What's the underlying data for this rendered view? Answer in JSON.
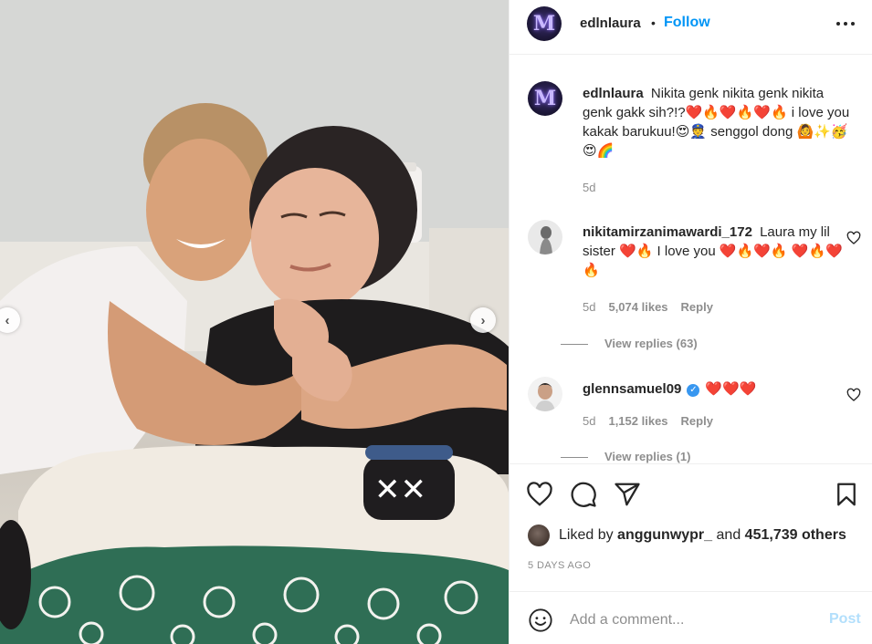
{
  "post": {
    "author": "edlnlaura",
    "follow_label": "Follow",
    "separator": "•",
    "caption": {
      "username": "edlnlaura",
      "text": "Nikita genk nikita genk nikita genk gakk sih?!?❤️🔥❤️🔥❤️🔥 i love you kakak barukuu!😍👮 senggol dong 🙆✨🥳😍🌈",
      "age": "5d"
    },
    "comments": [
      {
        "username": "nikitamirzanimawardi_172",
        "text": "Laura my lil sister ❤️🔥 I love you ❤️🔥❤️🔥 ❤️🔥❤️🔥",
        "age": "5d",
        "likes": "5,074 likes",
        "reply_label": "Reply",
        "view_replies": "View replies (63)"
      },
      {
        "username": "glennsamuel09",
        "verified": "✓",
        "text": "❤️❤️❤️",
        "age": "5d",
        "likes": "1,152 likes",
        "reply_label": "Reply",
        "view_replies": "View replies (1)"
      }
    ],
    "liked_by_prefix": "Liked by",
    "liked_by_user": "anggunwypr_",
    "liked_by_and": "and",
    "liked_by_others": "451,739 others",
    "timestamp": "5 DAYS AGO",
    "comment_placeholder": "Add a comment...",
    "post_label": "Post",
    "carousel": {
      "prev": "‹",
      "next": "›"
    },
    "logo_letter": "M"
  },
  "icons": {
    "more": "more-options-icon",
    "like": "heart-icon",
    "comment": "comment-icon",
    "share": "share-icon",
    "save": "bookmark-icon",
    "emoji": "smiley-icon",
    "small_like": "heart-icon"
  },
  "colors": {
    "link": "#0095f6",
    "text": "#262626",
    "muted": "#8e8e8e",
    "border": "#efefef",
    "post_disabled": "#b2dffc",
    "verified": "#3897f0"
  }
}
